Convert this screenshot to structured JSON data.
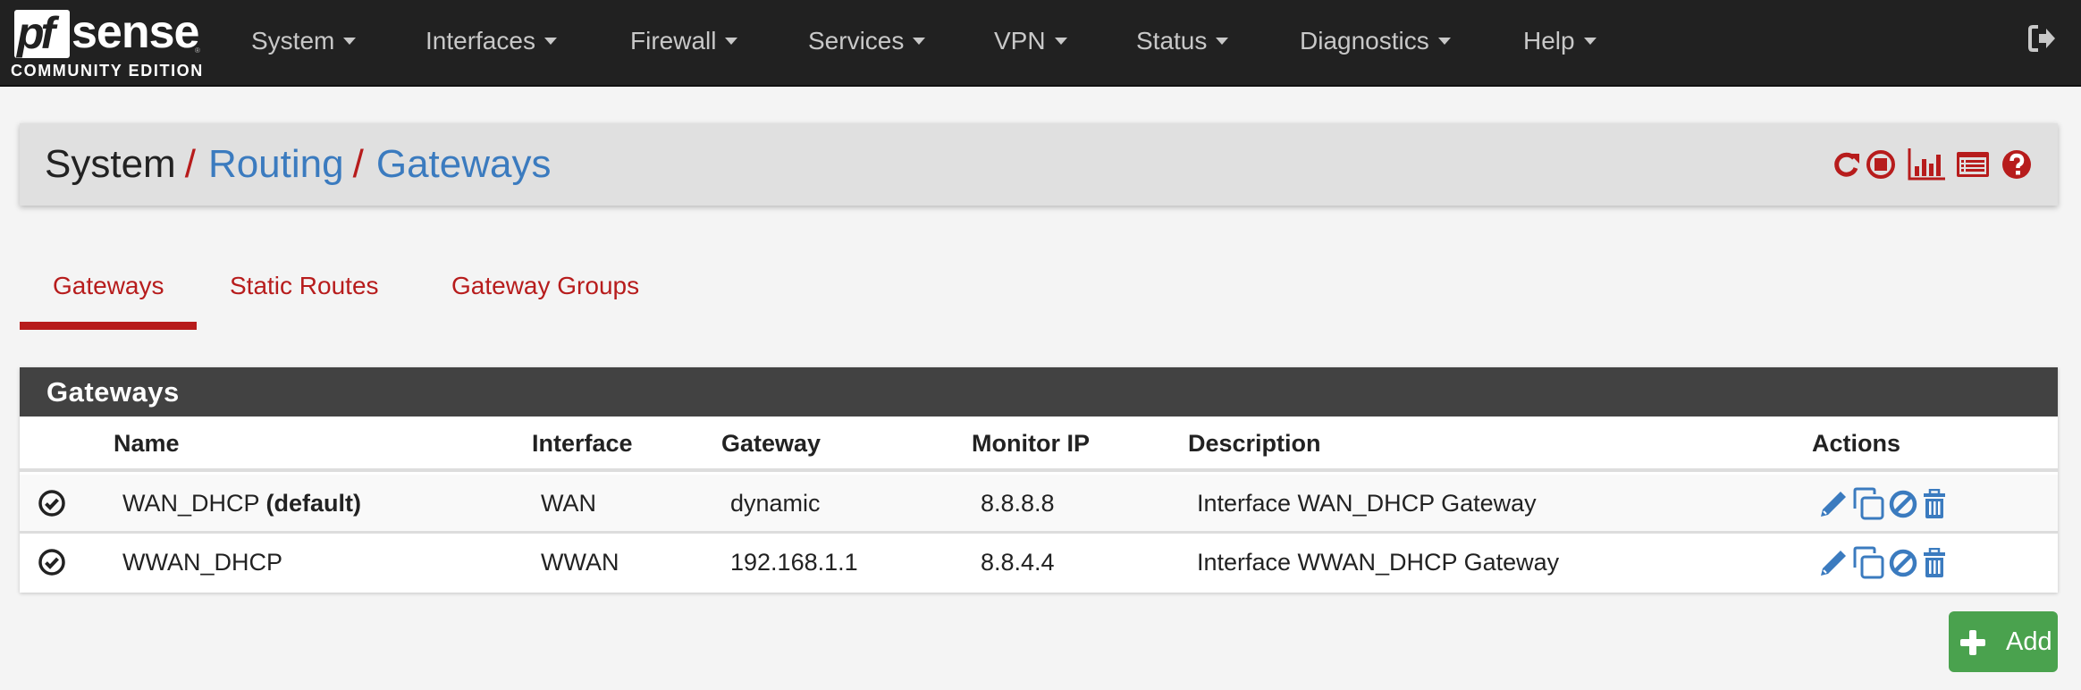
{
  "navbar": {
    "logo": {
      "mark": "pf",
      "word": "sense",
      "edition": "COMMUNITY EDITION",
      "registered": "®"
    },
    "menu": [
      {
        "label": "System"
      },
      {
        "label": "Interfaces"
      },
      {
        "label": "Firewall"
      },
      {
        "label": "Services"
      },
      {
        "label": "VPN"
      },
      {
        "label": "Status"
      },
      {
        "label": "Diagnostics"
      },
      {
        "label": "Help"
      }
    ],
    "logout_icon": "sign-out-icon"
  },
  "breadcrumb": {
    "items": [
      {
        "label": "System",
        "link": false
      },
      {
        "label": "Routing",
        "link": true
      },
      {
        "label": "Gateways",
        "link": true
      }
    ],
    "separator": "/",
    "icons": [
      "reload-icon",
      "stop-icon",
      "bar-chart-icon",
      "list-alt-icon",
      "help-icon"
    ],
    "icon_color": "#b71c1c"
  },
  "tabs": [
    {
      "label": "Gateways",
      "active": true
    },
    {
      "label": "Static Routes",
      "active": false
    },
    {
      "label": "Gateway Groups",
      "active": false
    }
  ],
  "panel": {
    "title": "Gateways",
    "columns": [
      "",
      "Name",
      "Interface",
      "Gateway",
      "Monitor IP",
      "Description",
      "Actions"
    ],
    "rows": [
      {
        "status_icon": "check-circle-icon",
        "name": "WAN_DHCP",
        "name_suffix": "(default)",
        "interface": "WAN",
        "gateway": "dynamic",
        "monitor_ip": "8.8.8.8",
        "description": "Interface WAN_DHCP Gateway",
        "actions": [
          "edit-icon",
          "copy-icon",
          "disable-icon",
          "delete-icon"
        ]
      },
      {
        "status_icon": "check-circle-icon",
        "name": "WWAN_DHCP",
        "name_suffix": "",
        "interface": "WWAN",
        "gateway": "192.168.1.1",
        "monitor_ip": "8.8.4.4",
        "description": "Interface WWAN_DHCP Gateway",
        "actions": [
          "edit-icon",
          "copy-icon",
          "disable-icon",
          "delete-icon"
        ]
      }
    ],
    "action_color": "#3b7bbf"
  },
  "add_button": {
    "label": "Add",
    "icon": "plus-icon",
    "color": "#4aa24e"
  }
}
